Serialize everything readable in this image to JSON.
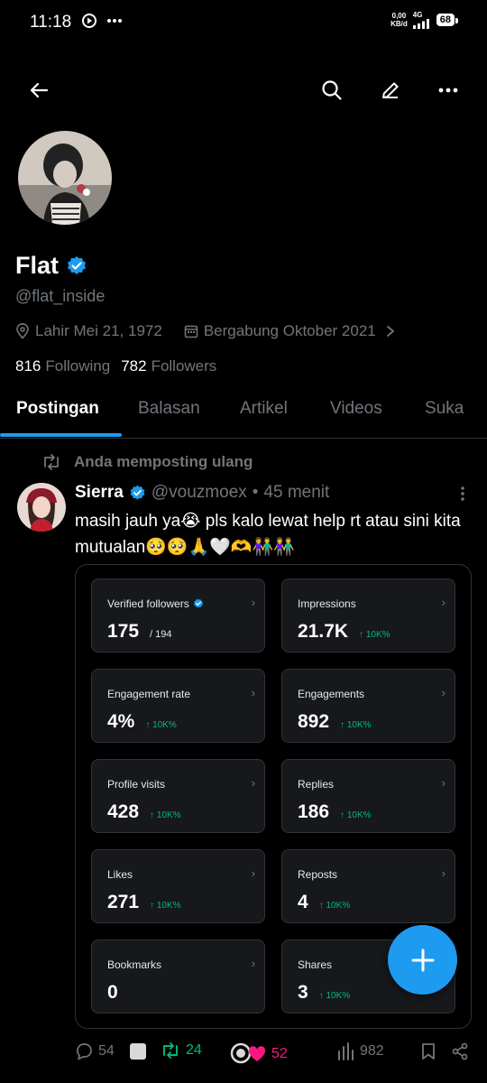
{
  "status_bar": {
    "time": "11:18",
    "net_speed_value": "0,00",
    "net_speed_unit": "KB/d",
    "network_type": "4G",
    "battery": "68"
  },
  "profile": {
    "name": "Flat",
    "handle": "@flat_inside",
    "birth": "Lahir Mei 21, 1972",
    "joined": "Bergabung Oktober 2021",
    "following_count": "816",
    "following_label": "Following",
    "followers_count": "782",
    "followers_label": "Followers"
  },
  "tabs": [
    "Postingan",
    "Balasan",
    "Artikel",
    "Videos",
    "Suka"
  ],
  "post": {
    "repost_note": "Anda memposting ulang",
    "author": "Sierra",
    "handle": "@vouzmoex",
    "dot": "•",
    "time": "45 menit",
    "text": "masih jauh ya😭 pls kalo lewat help rt atau sini kita mutualan🥺🥺🙏🤍🫶👫👫"
  },
  "analytics": [
    {
      "label": "Verified followers",
      "value": "175",
      "sub": "/ 194",
      "delta": "",
      "verified": true
    },
    {
      "label": "Impressions",
      "value": "21.7K",
      "sub": "",
      "delta": "↑ 10K%"
    },
    {
      "label": "Engagement rate",
      "value": "4%",
      "sub": "",
      "delta": "↑ 10K%"
    },
    {
      "label": "Engagements",
      "value": "892",
      "sub": "",
      "delta": "↑ 10K%"
    },
    {
      "label": "Profile visits",
      "value": "428",
      "sub": "",
      "delta": "↑ 10K%"
    },
    {
      "label": "Replies",
      "value": "186",
      "sub": "",
      "delta": "↑ 10K%"
    },
    {
      "label": "Likes",
      "value": "271",
      "sub": "",
      "delta": "↑ 10K%"
    },
    {
      "label": "Reposts",
      "value": "4",
      "sub": "",
      "delta": "↑ 10K%"
    },
    {
      "label": "Bookmarks",
      "value": "0",
      "sub": "",
      "delta": ""
    },
    {
      "label": "Shares",
      "value": "3",
      "sub": "",
      "delta": "↑ 10K%"
    }
  ],
  "actions": {
    "replies": "54",
    "reposts": "24",
    "likes": "52",
    "views": "982"
  },
  "colors": {
    "accent": "#1d9bf0",
    "repost_green": "#00ba7c",
    "like_pink": "#f91880",
    "muted": "#71767b"
  }
}
